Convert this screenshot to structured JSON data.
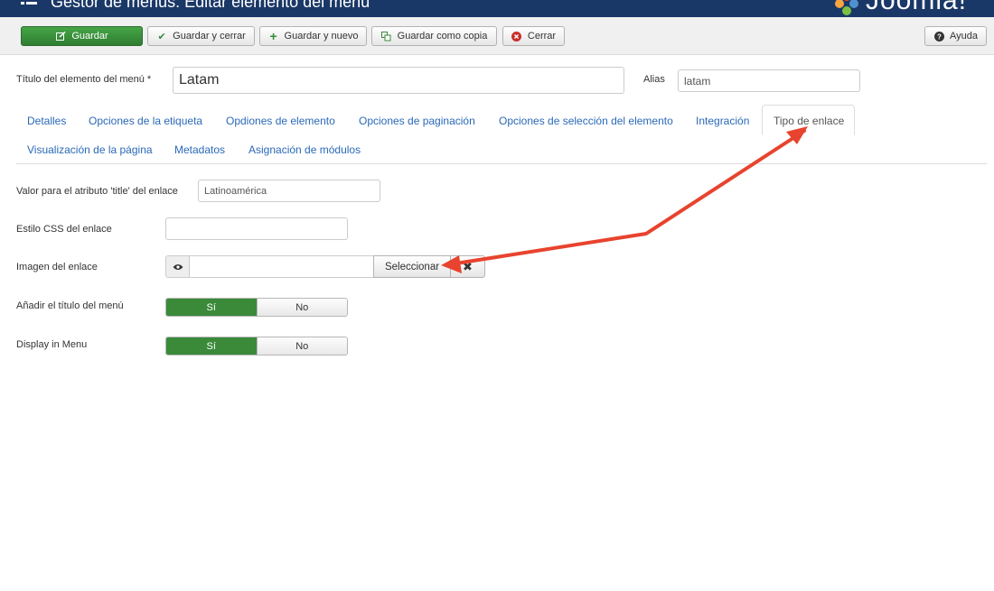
{
  "header": {
    "title": "Gestor de menús: Editar elemento del menú",
    "logo_text": "Joomla!"
  },
  "toolbar": {
    "save_label": "Guardar",
    "save_close_label": "Guardar y cerrar",
    "save_new_label": "Guardar y nuevo",
    "save_copy_label": "Guardar como copia",
    "close_label": "Cerrar",
    "help_label": "Ayuda"
  },
  "form": {
    "title_label": "Título del elemento del menú *",
    "title_value": "Latam",
    "alias_label": "Alias",
    "alias_value": "latam"
  },
  "tabs": [
    {
      "label": "Detalles"
    },
    {
      "label": "Opciones de la etiqueta"
    },
    {
      "label": "Opdiones de elemento"
    },
    {
      "label": "Opciones de paginación"
    },
    {
      "label": "Opciones de selección del elemento"
    },
    {
      "label": "Integración"
    },
    {
      "label": "Tipo de enlace",
      "active": true
    },
    {
      "label": "Visualización de la página"
    },
    {
      "label": "Metadatos"
    },
    {
      "label": "Asignación de módulos"
    }
  ],
  "link_type": {
    "title_attr_label": "Valor para el atributo 'title' del enlace",
    "title_attr_value": "Latinoamérica",
    "css_label": "Estilo CSS del enlace",
    "css_value": "",
    "image_label": "Imagen del enlace",
    "image_value": "",
    "select_label": "Seleccionar",
    "add_title_label": "Añadir el título del menú",
    "add_title_yes": "Sí",
    "add_title_no": "No",
    "display_label": "Display in Menu",
    "display_yes": "Sí",
    "display_no": "No"
  },
  "colors": {
    "header_bg": "#1a3867",
    "primary_green": "#2f7d32",
    "link_blue": "#2a69b8",
    "annotation_red": "#e8432e"
  }
}
